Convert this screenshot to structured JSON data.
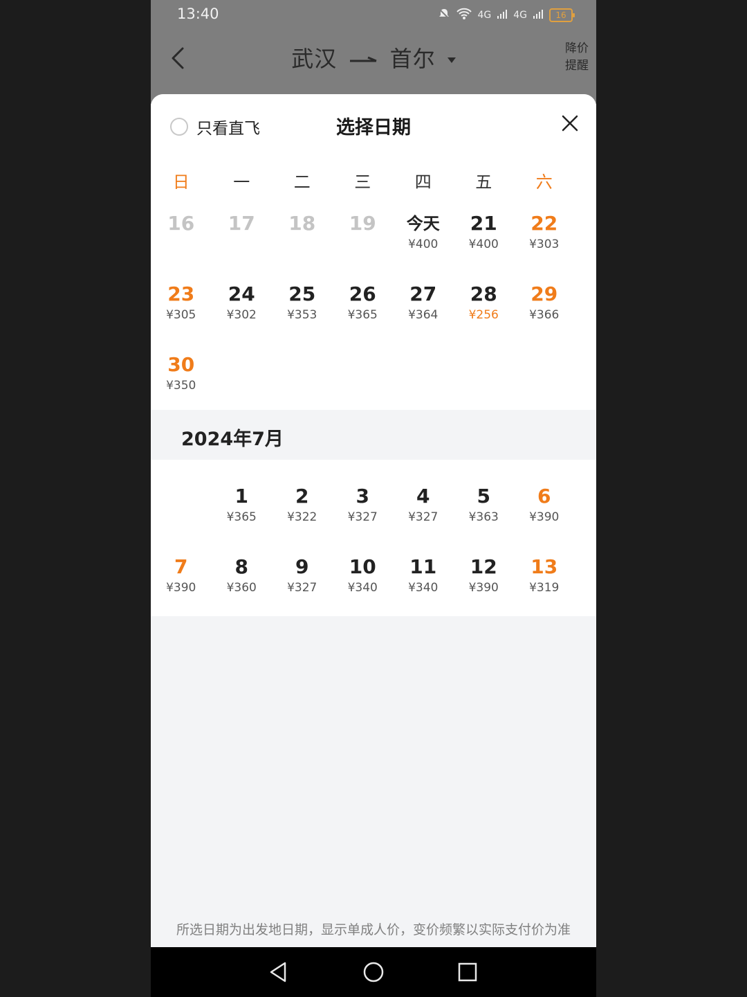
{
  "status_bar": {
    "time": "13:40",
    "network_a": "4G",
    "network_b": "4G",
    "battery": "16"
  },
  "header": {
    "route_from": "武汉",
    "route_to": "首尔",
    "price_alert_line1": "降价",
    "price_alert_line2": "提醒"
  },
  "sheet": {
    "direct_only_label": "只看直飞",
    "title": "选择日期"
  },
  "weekdays": [
    "日",
    "一",
    "二",
    "三",
    "四",
    "五",
    "六"
  ],
  "june": {
    "rows": [
      [
        {
          "day": "16",
          "price": ""
        },
        {
          "day": "17",
          "price": ""
        },
        {
          "day": "18",
          "price": ""
        },
        {
          "day": "19",
          "price": ""
        },
        {
          "day": "今天",
          "price": "¥400"
        },
        {
          "day": "21",
          "price": "¥400"
        },
        {
          "day": "22",
          "price": "¥303"
        }
      ],
      [
        {
          "day": "23",
          "price": "¥305"
        },
        {
          "day": "24",
          "price": "¥302"
        },
        {
          "day": "25",
          "price": "¥353"
        },
        {
          "day": "26",
          "price": "¥365"
        },
        {
          "day": "27",
          "price": "¥364"
        },
        {
          "day": "28",
          "price": "¥256"
        },
        {
          "day": "29",
          "price": "¥366"
        }
      ],
      [
        {
          "day": "30",
          "price": "¥350"
        }
      ]
    ]
  },
  "july": {
    "title": "2024年7月",
    "rows": [
      [
        {
          "day": "",
          "price": ""
        },
        {
          "day": "1",
          "price": "¥365"
        },
        {
          "day": "2",
          "price": "¥322"
        },
        {
          "day": "3",
          "price": "¥327"
        },
        {
          "day": "4",
          "price": "¥327"
        },
        {
          "day": "5",
          "price": "¥363"
        },
        {
          "day": "6",
          "price": "¥390"
        }
      ],
      [
        {
          "day": "7",
          "price": "¥390"
        },
        {
          "day": "8",
          "price": "¥360"
        },
        {
          "day": "9",
          "price": "¥327"
        },
        {
          "day": "10",
          "price": "¥340"
        },
        {
          "day": "11",
          "price": "¥340"
        },
        {
          "day": "12",
          "price": "¥390"
        },
        {
          "day": "13",
          "price": "¥319"
        }
      ]
    ]
  },
  "footer_note": "所选日期为出发地日期，显示单成人价，变价频繁以实际支付价为准",
  "colors": {
    "accent": "#f07c1a",
    "past": "#c4c4c4"
  }
}
